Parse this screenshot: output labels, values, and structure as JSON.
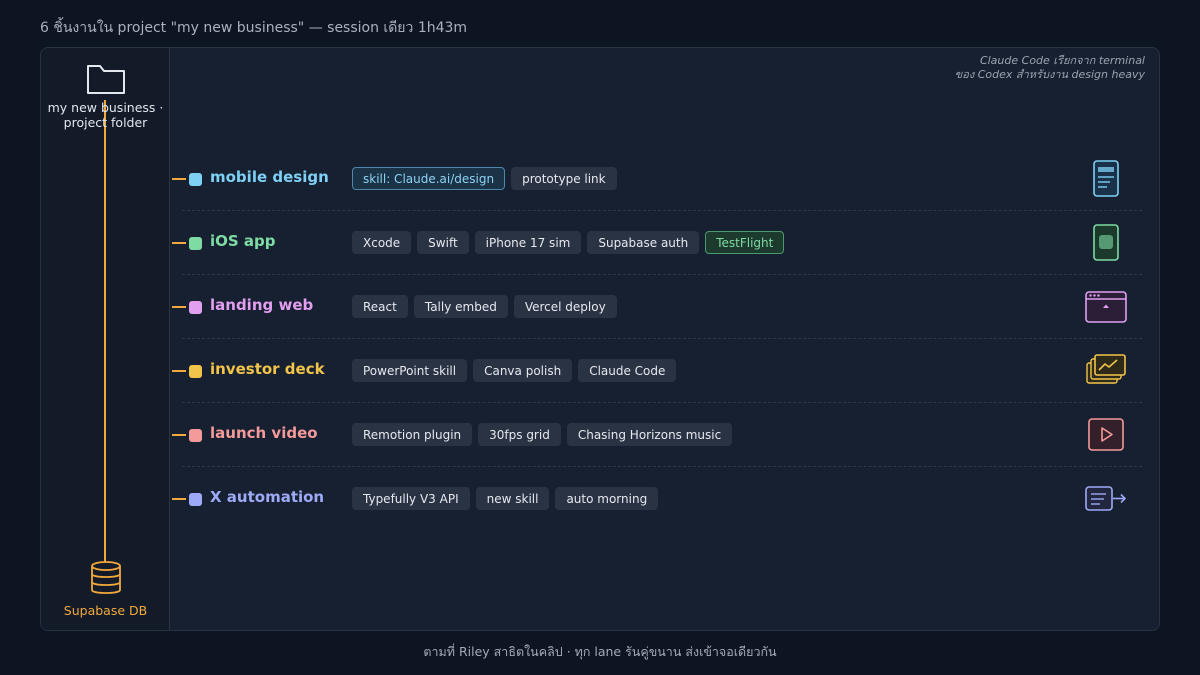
{
  "title": "6 ชิ้นงานใน project \"my new business\" — session เดียว 1h43m",
  "sidebar": {
    "folder_label": "my new business · project folder",
    "db_label": "Supabase DB",
    "folder_icon": "folder-icon",
    "db_icon": "database-icon"
  },
  "note": {
    "line1": "Claude Code เรียกจาก terminal",
    "line2": "ของ Codex สำหรับงาน design heavy"
  },
  "lanes": [
    {
      "name": "mobile design",
      "color": "#7fd0f5",
      "icon": "phone-mockup-icon",
      "chips": [
        {
          "label": "skill: Claude.ai/design",
          "style": "blue"
        },
        {
          "label": "prototype link",
          "style": "plain"
        }
      ]
    },
    {
      "name": "iOS app",
      "color": "#7ddba3",
      "icon": "iphone-app-icon",
      "chips": [
        {
          "label": "Xcode",
          "style": "plain"
        },
        {
          "label": "Swift",
          "style": "plain"
        },
        {
          "label": "iPhone 17 sim",
          "style": "plain"
        },
        {
          "label": "Supabase auth",
          "style": "plain"
        },
        {
          "label": "TestFlight",
          "style": "green"
        }
      ]
    },
    {
      "name": "landing web",
      "color": "#e29ff0",
      "icon": "browser-window-icon",
      "chips": [
        {
          "label": "React",
          "style": "plain"
        },
        {
          "label": "Tally embed",
          "style": "plain"
        },
        {
          "label": "Vercel deploy",
          "style": "plain"
        }
      ]
    },
    {
      "name": "investor deck",
      "color": "#f2c44a",
      "icon": "slide-deck-chart-icon",
      "chips": [
        {
          "label": "PowerPoint skill",
          "style": "plain"
        },
        {
          "label": "Canva polish",
          "style": "plain"
        },
        {
          "label": "Claude Code",
          "style": "plain"
        }
      ]
    },
    {
      "name": "launch video",
      "color": "#f49a9a",
      "icon": "play-video-icon",
      "chips": [
        {
          "label": "Remotion plugin",
          "style": "plain"
        },
        {
          "label": "30fps grid",
          "style": "plain"
        },
        {
          "label": "Chasing Horizons music",
          "style": "plain"
        }
      ]
    },
    {
      "name": "X automation",
      "color": "#9eaaf7",
      "icon": "post-send-arrow-icon",
      "chips": [
        {
          "label": "Typefully V3 API",
          "style": "plain"
        },
        {
          "label": "new skill",
          "style": "plain"
        },
        {
          "label": "auto morning",
          "style": "plain"
        }
      ]
    }
  ],
  "footer": "ตามที่ Riley สาธิตในคลิป · ทุก lane รันคู่ขนาน ส่งเข้าจอเดียวกัน",
  "colors": {
    "background": "#0e1522",
    "panel": "#172030",
    "connector": "#f2a93b"
  }
}
